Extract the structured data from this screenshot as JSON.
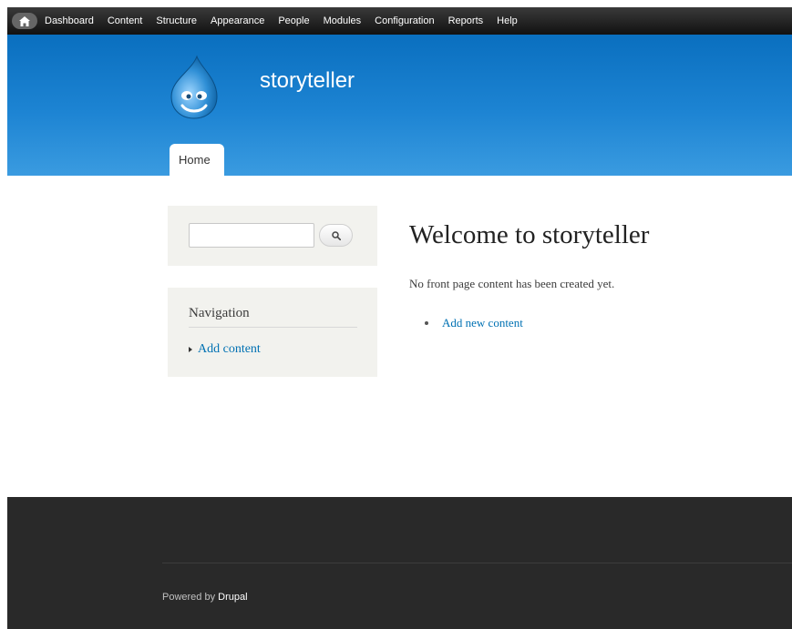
{
  "toolbar": {
    "items": [
      "Dashboard",
      "Content",
      "Structure",
      "Appearance",
      "People",
      "Modules",
      "Configuration",
      "Reports",
      "Help"
    ]
  },
  "header": {
    "site_name": "storyteller",
    "tabs": [
      {
        "label": "Home"
      }
    ]
  },
  "sidebar": {
    "search": {
      "placeholder": "",
      "value": ""
    },
    "navigation": {
      "title": "Navigation",
      "items": [
        {
          "label": "Add content"
        }
      ]
    }
  },
  "main": {
    "title": "Welcome to storyteller",
    "empty_text": "No front page content has been created yet.",
    "links": [
      {
        "label": "Add new content"
      }
    ]
  },
  "footer": {
    "prefix": "Powered by ",
    "link": "Drupal"
  },
  "colors": {
    "header_blue": "#1d84d3",
    "link": "#0071b3",
    "footer_bg": "#292929"
  },
  "icons": {
    "home": "home-icon",
    "search": "search-icon",
    "logo": "drupal-logo-icon"
  }
}
